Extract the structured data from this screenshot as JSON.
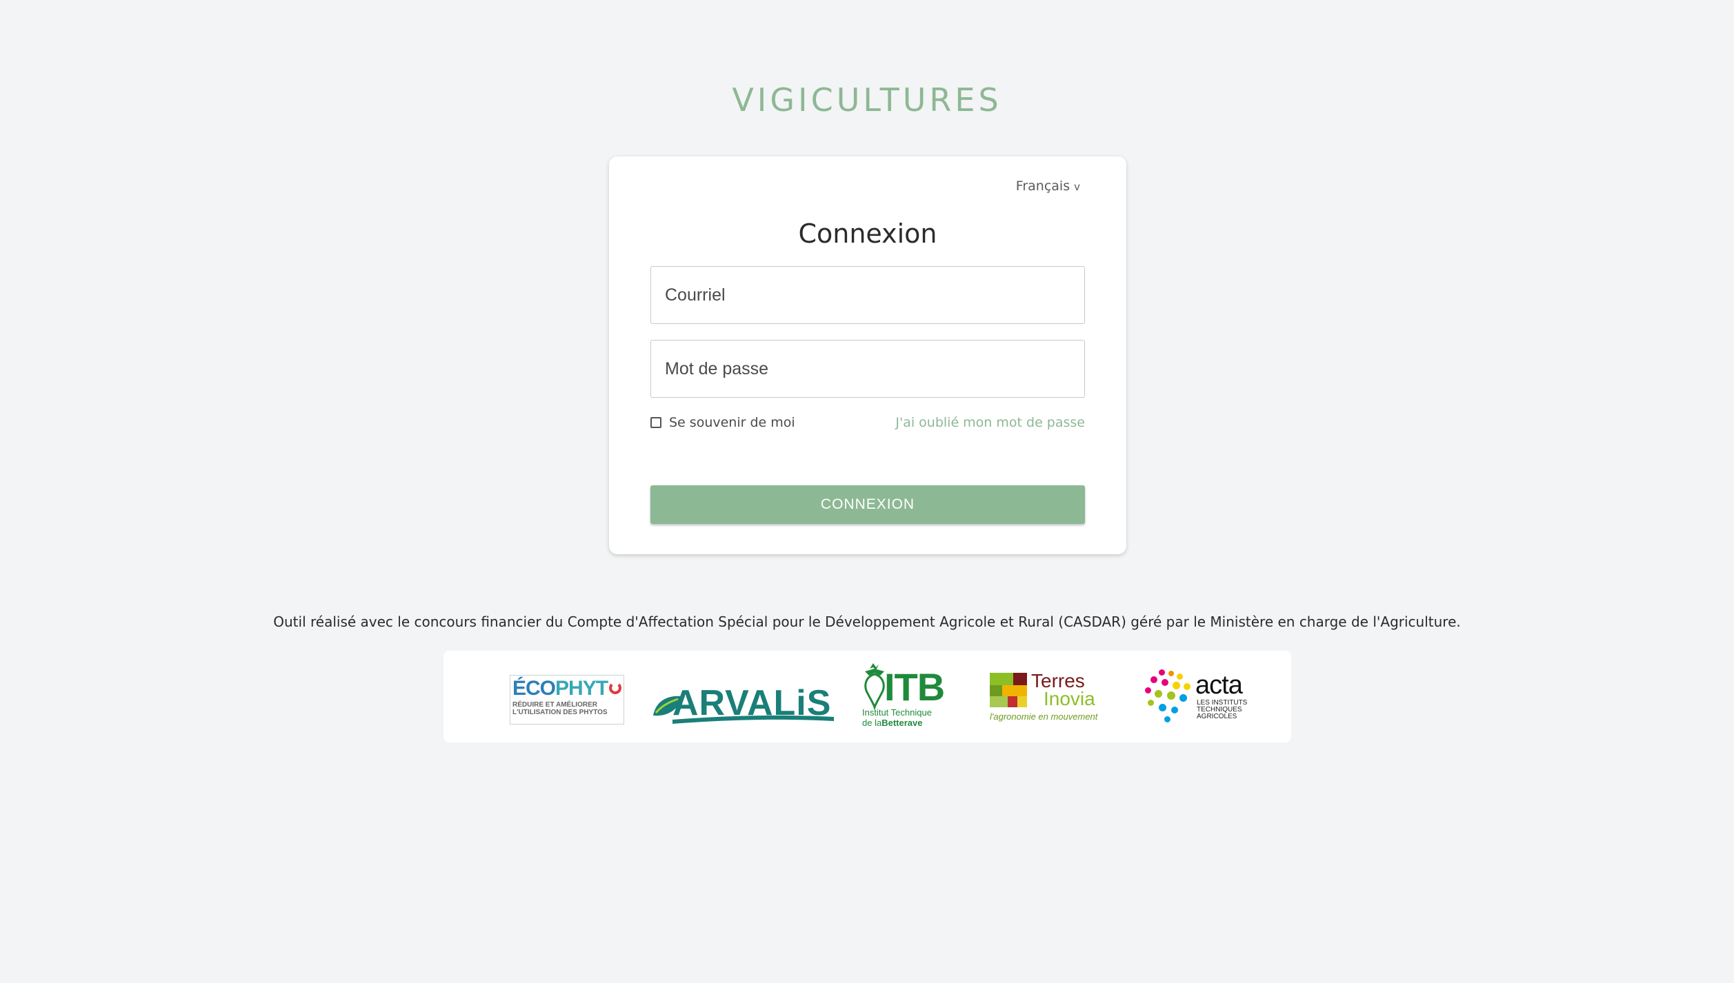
{
  "app": {
    "title": "VIGICULTURES"
  },
  "login": {
    "language": "Français",
    "title": "Connexion",
    "email_placeholder": "Courriel",
    "password_placeholder": "Mot de passe",
    "remember_label": "Se souvenir de moi",
    "remember_checked": false,
    "forgot_link": "J'ai oublié mon mot de passe",
    "submit_label": "CONNEXION"
  },
  "footer": {
    "funding_text": "Outil réalisé avec le concours financier du Compte d'Affectation Spécial pour le Développement Agricole et Rural (CASDAR) géré par le Ministère en charge de l'Agriculture.",
    "logos": {
      "ecophyto": {
        "main_1": "ÉCO",
        "main_2": "PHYT",
        "line_1": "RÉDUIRE ET AMÉLIORER",
        "line_2": "L'UTILISATION DES PHYTOS"
      },
      "arvalis": {
        "name": "ARVALiS"
      },
      "itb": {
        "name": "ITB",
        "line_1": "Institut Technique",
        "line_2a": "de la",
        "line_2b": "Betterave"
      },
      "terres_inovia": {
        "word_1": "Terres",
        "word_2": "Inovia",
        "tagline": "l'agronomie en mouvement"
      },
      "acta": {
        "name": "acta",
        "line_1": "LES INSTITUTS",
        "line_2": "TECHNIQUES",
        "line_3": "AGRICOLES"
      }
    }
  },
  "colors": {
    "accent": "#8db894",
    "background": "#f3f4f5"
  }
}
